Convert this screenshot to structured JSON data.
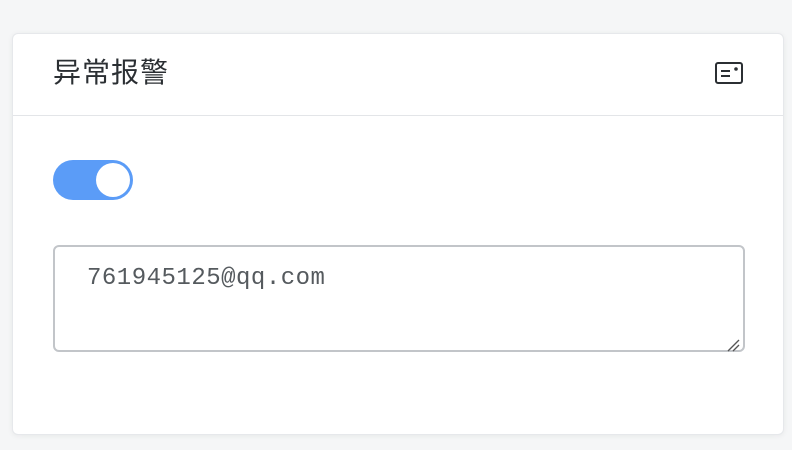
{
  "card": {
    "title": "异常报警",
    "header_icon": "card-id-icon"
  },
  "alarm_toggle": {
    "enabled": true,
    "accent_color": "#5b9cf7"
  },
  "email_field": {
    "value": "761945125@qq.com"
  }
}
